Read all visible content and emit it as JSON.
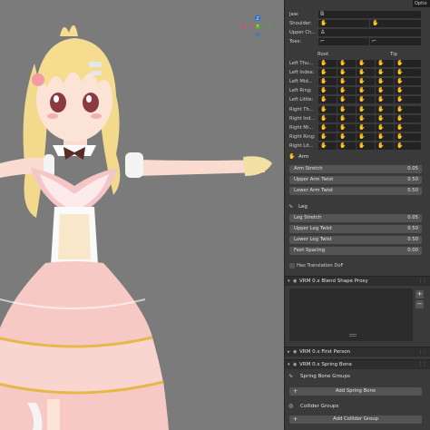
{
  "header": {
    "options_tab": "Optio"
  },
  "finger_table": {
    "col_root": "Root",
    "col_tip": "Tip",
    "top_rows": [
      {
        "label": "Jaw:"
      },
      {
        "label": "Shoulder:"
      },
      {
        "label": "Upper Ch..."
      },
      {
        "label": "Toes:"
      }
    ],
    "left_hand": [
      "Left Thu...",
      "Left Index:",
      "Left Mid...",
      "Left Ring:",
      "Left Little:"
    ],
    "right_hand": [
      "Right Th...",
      "Right Ind...",
      "Right Mi...",
      "Right Ring:",
      "Right Lit..."
    ]
  },
  "arm": {
    "title": "Arm",
    "props": [
      {
        "name": "Arm Stretch",
        "value": "0.05"
      },
      {
        "name": "Upper Arm Twist",
        "value": "0.50"
      },
      {
        "name": "Lower Arm Twist",
        "value": "0.50"
      }
    ]
  },
  "leg": {
    "title": "Leg",
    "props": [
      {
        "name": "Leg Stretch",
        "value": "0.05"
      },
      {
        "name": "Upper Leg Twist",
        "value": "0.50"
      },
      {
        "name": "Lower Leg Twist",
        "value": "0.50"
      },
      {
        "name": "Feet Spacing",
        "value": "0.00"
      }
    ]
  },
  "translation_dof": {
    "label": "Has Translation DoF",
    "checked": false
  },
  "blend_shape": {
    "title": "VRM 0.x Blend Shape Proxy",
    "add": "+",
    "remove": "−"
  },
  "first_person": {
    "title": "VRM 0.x First Person"
  },
  "spring_bone": {
    "title": "VRM 0.x Spring Bone",
    "spring_groups_label": "Spring Bone Groups",
    "add_spring_button": "Add Spring Bone",
    "collider_groups_label": "Collider Groups",
    "add_collider_button": "Add Collider Group"
  },
  "gizmo": {
    "z": "Z",
    "y": "Y",
    "x": "X"
  },
  "icons": {
    "hand": "hand-icon",
    "bone": "bone-icon",
    "arm": "arm-icon",
    "leg": "leg-icon",
    "eye": "eye-icon",
    "spring": "spring-icon",
    "collider": "collider-icon"
  },
  "colors": {
    "panel_bg": "#3a3a3a",
    "field_bg": "#232323",
    "slider_bg": "#545454",
    "viewport_bg": "#7b7b7b",
    "gizmo_z": "#2c6fd6",
    "gizmo_y": "#5aa63a",
    "gizmo_x": "#d84a6a"
  }
}
